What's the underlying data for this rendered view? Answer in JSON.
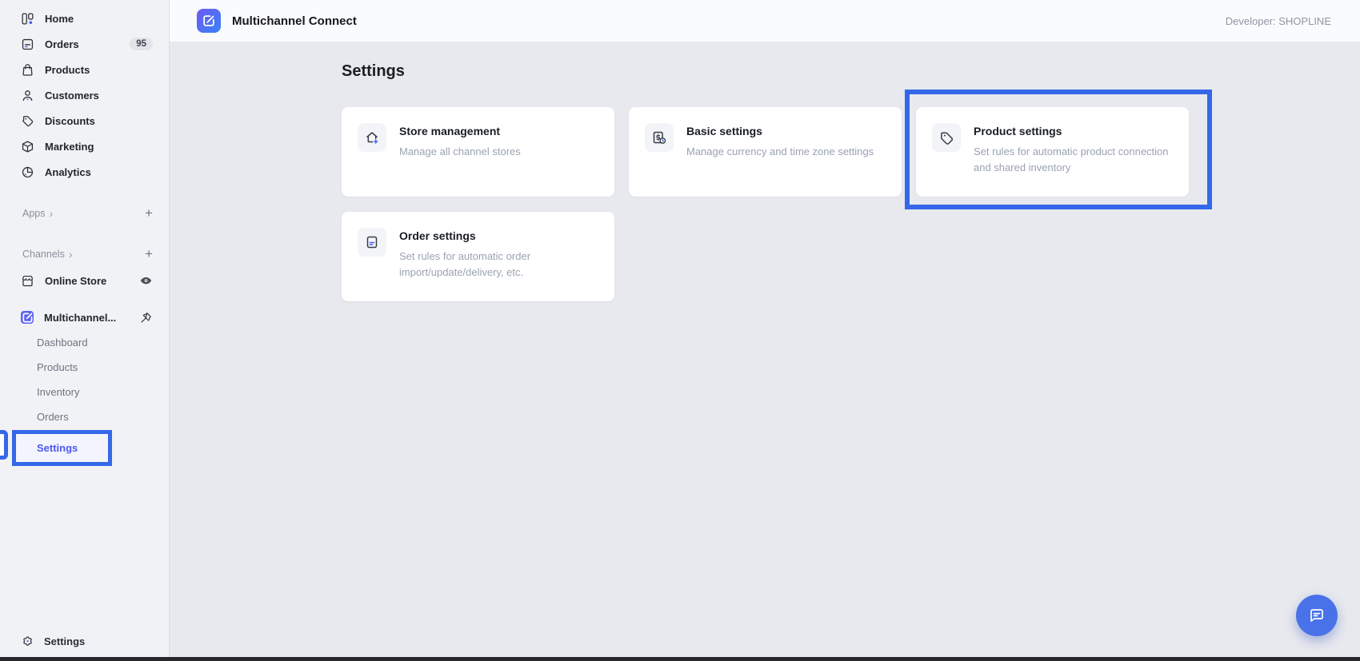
{
  "header": {
    "title": "Multichannel Connect",
    "developer": "Developer: SHOPLINE",
    "app_icon": "multichannel-connect-app-icon"
  },
  "sidebar": {
    "nav": [
      {
        "label": "Home",
        "icon": "home-icon"
      },
      {
        "label": "Orders",
        "icon": "orders-icon",
        "badge": "95"
      },
      {
        "label": "Products",
        "icon": "products-icon"
      },
      {
        "label": "Customers",
        "icon": "customers-icon"
      },
      {
        "label": "Discounts",
        "icon": "discounts-icon"
      },
      {
        "label": "Marketing",
        "icon": "marketing-icon"
      },
      {
        "label": "Analytics",
        "icon": "analytics-icon"
      }
    ],
    "sections": [
      {
        "label": "Apps",
        "chevron": "›",
        "plus": "+"
      },
      {
        "label": "Channels",
        "chevron": "›",
        "plus": "+"
      }
    ],
    "online_store": {
      "label": "Online Store",
      "icon": "storefront-icon",
      "right_icon": "eye-icon"
    },
    "app_item": {
      "label": "Multichannel...",
      "icon": "multichannel-mini-icon",
      "right_icon": "pin-icon"
    },
    "subnav": [
      {
        "label": "Dashboard"
      },
      {
        "label": "Products"
      },
      {
        "label": "Inventory"
      },
      {
        "label": "Orders"
      },
      {
        "label": "Settings",
        "active": true
      }
    ],
    "footer": {
      "label": "Settings",
      "icon": "gear-icon"
    }
  },
  "main": {
    "title": "Settings",
    "cards": [
      {
        "title": "Store management",
        "description": "Manage all channel stores",
        "icon": "store-management-icon",
        "highlighted": false
      },
      {
        "title": "Basic settings",
        "description": "Manage currency and time zone settings",
        "icon": "basic-settings-icon",
        "highlighted": false
      },
      {
        "title": "Product settings",
        "description": "Set rules for automatic product connection and shared inventory",
        "icon": "product-settings-icon",
        "highlighted": true
      },
      {
        "title": "Order settings",
        "description": "Set rules for automatic order import/update/delivery, etc.",
        "icon": "order-settings-icon",
        "highlighted": false
      }
    ]
  },
  "fab": {
    "icon": "chat-icon"
  },
  "colors": {
    "annotation_blue": "#3568e8",
    "accent_blue": "#4c5af0",
    "fab_blue": "#4a72e8",
    "sidebar_bg": "#f1f2f5",
    "main_bg": "#e7e9ee",
    "topbar_bg": "#fafbfd"
  }
}
